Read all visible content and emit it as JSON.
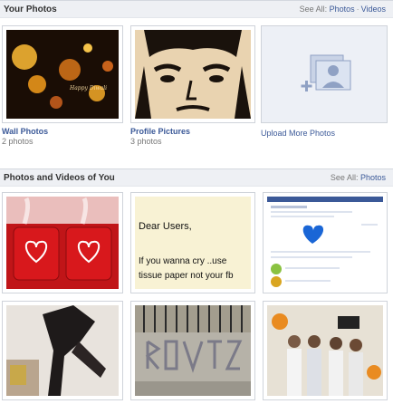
{
  "your_photos": {
    "title": "Your Photos",
    "see_all_prefix": "See All:",
    "see_all_photos": "Photos",
    "separator": "·",
    "see_all_videos": "Videos",
    "albums": [
      {
        "title": "Wall Photos",
        "count": "2 photos",
        "image_text": "Happy Diwali"
      },
      {
        "title": "Profile Pictures",
        "count": "3 photos"
      }
    ],
    "upload_label": "Upload More Photos"
  },
  "photos_of_you": {
    "title": "Photos and Videos of You",
    "see_all_prefix": "See All:",
    "see_all_photos": "Photos",
    "note_text": [
      "Dear Users,",
      "If you wanna cry ..use",
      "tissue paper not your fb"
    ]
  },
  "colors": {
    "link": "#3b5998",
    "header_bg": "#eef0f4",
    "border": "#cfd3da"
  }
}
